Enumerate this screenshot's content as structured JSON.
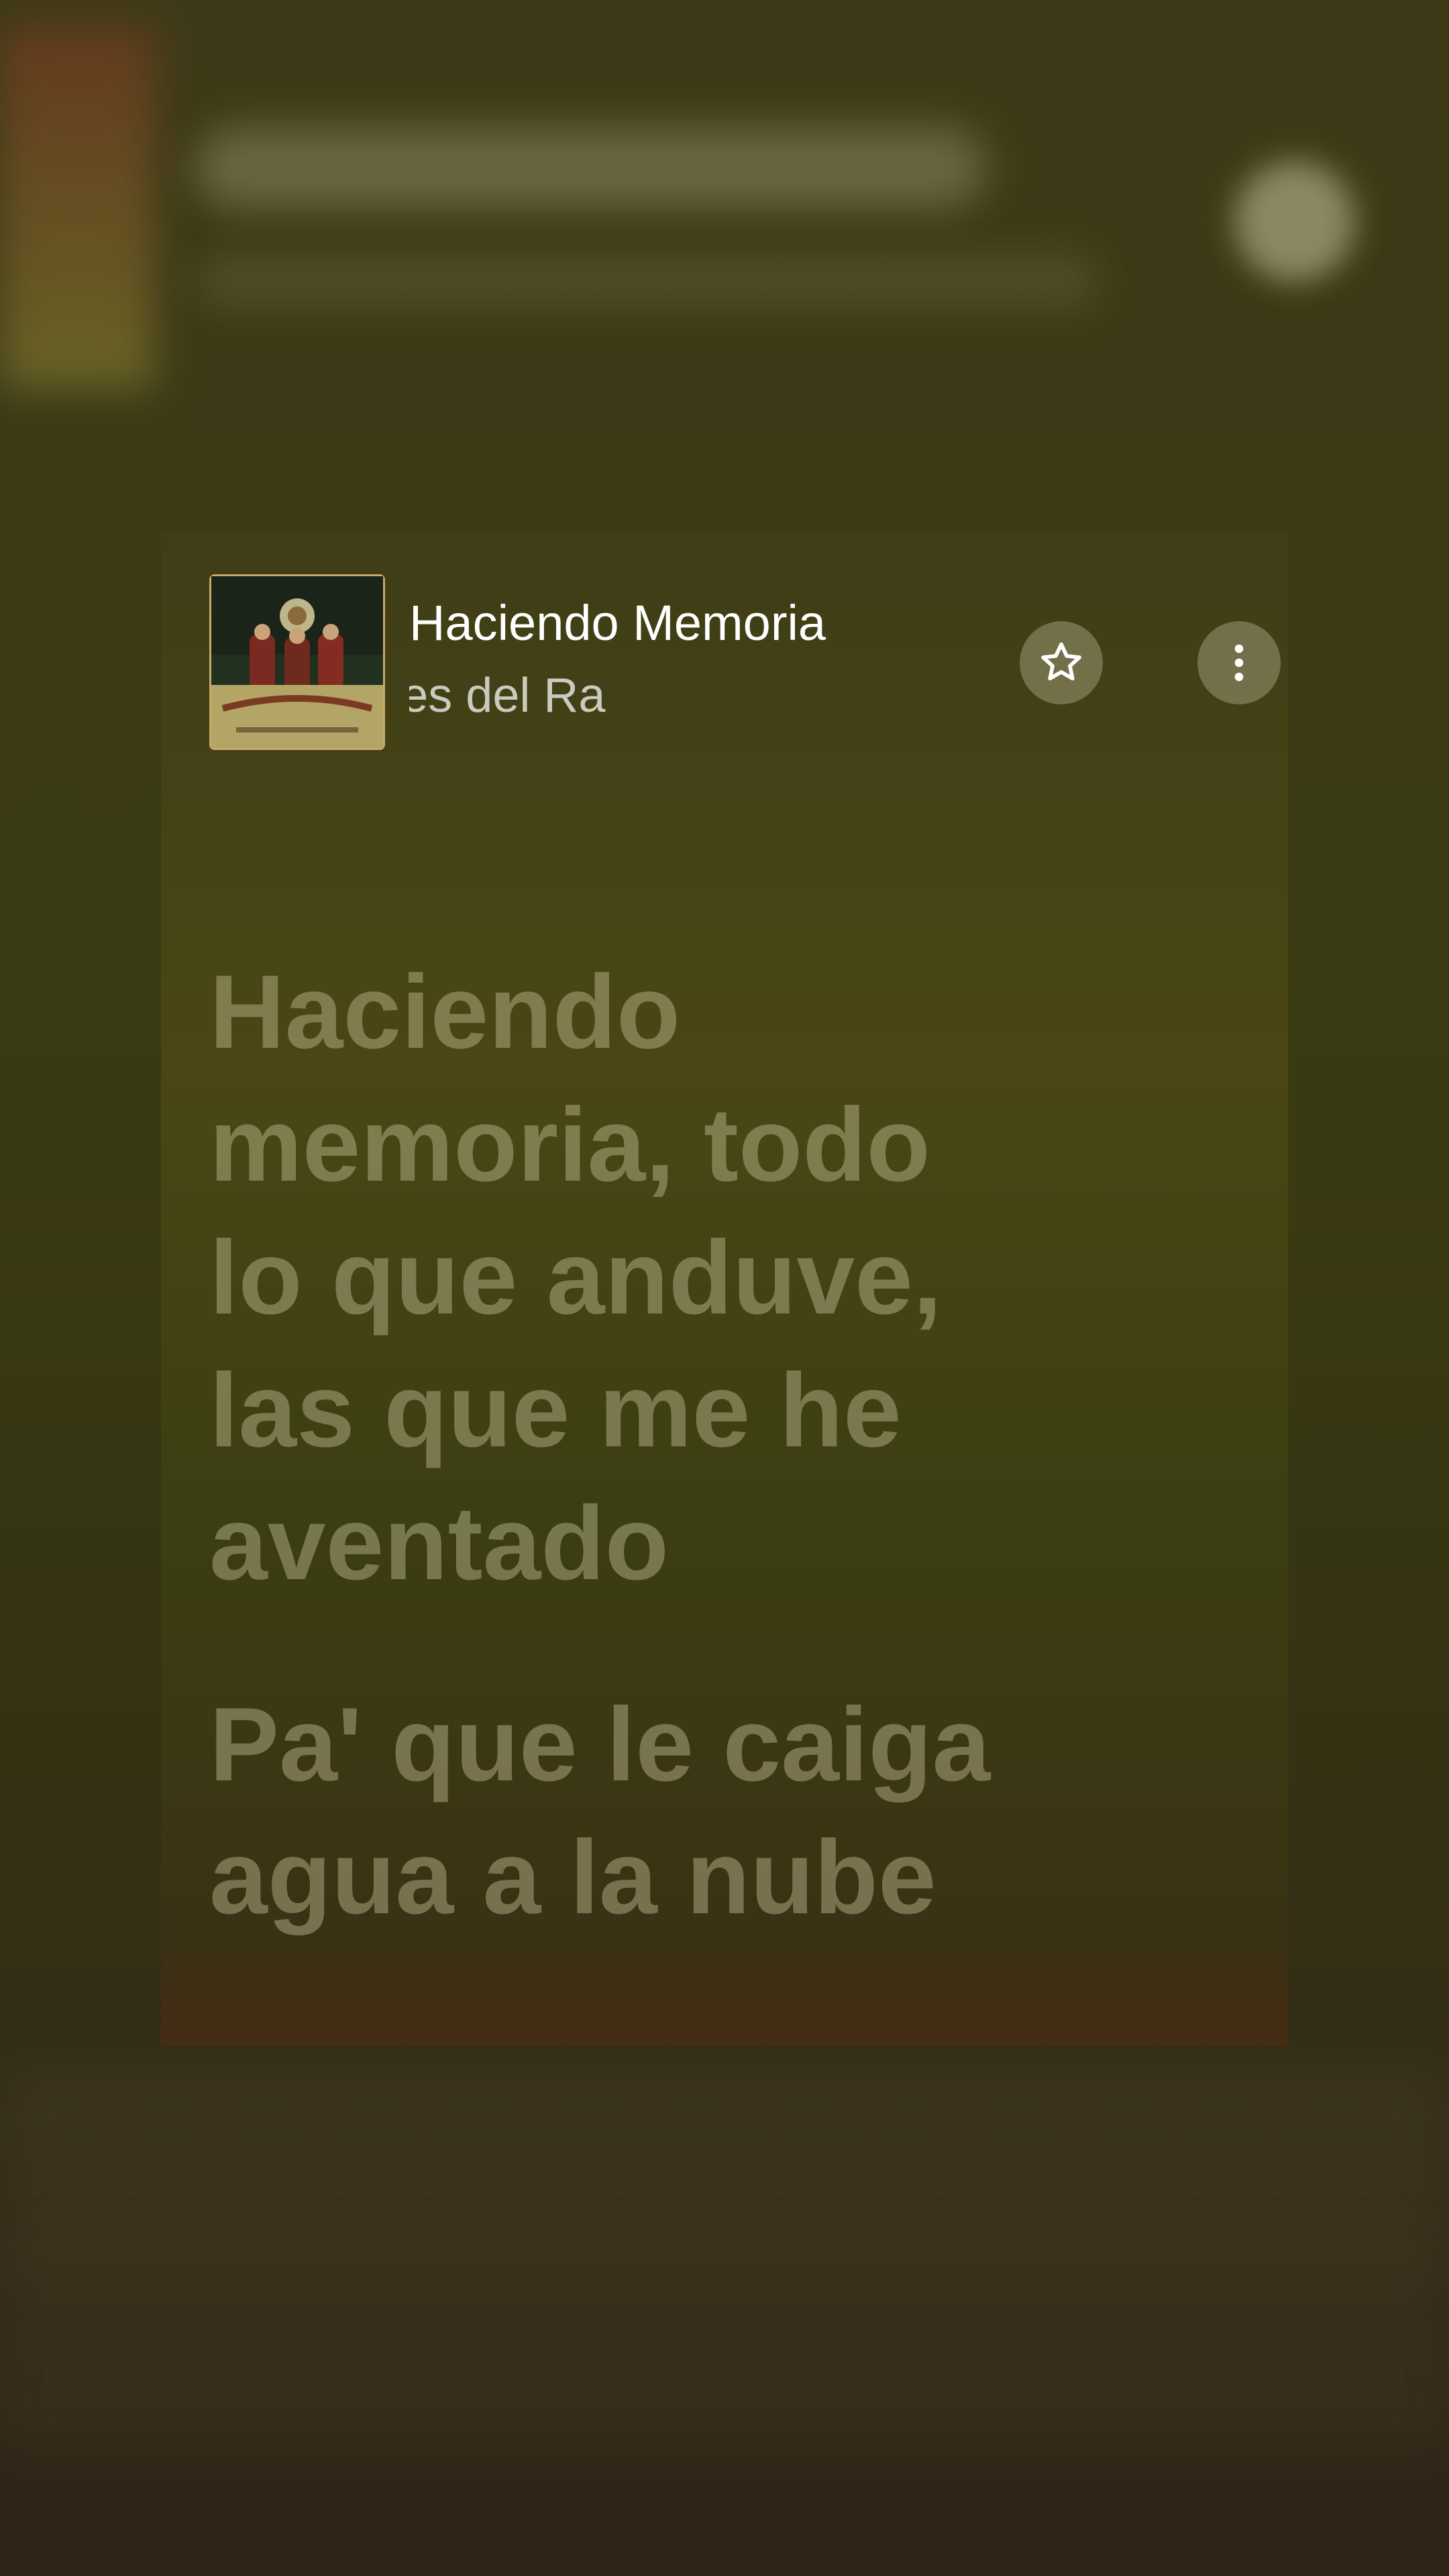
{
  "now_playing": {
    "title": "Haciendo Memoria",
    "artist_visible": "ma & Los Plebes del Ra",
    "album_art_icon": "album-art-image"
  },
  "actions": {
    "favorite_icon": "star-icon",
    "more_icon": "vertical-ellipsis-icon"
  },
  "lyrics": {
    "verses": [
      {
        "lines": [
          "Haciendo",
          "memoria, todo",
          "lo que anduve,",
          "las que me he",
          "aventado"
        ]
      },
      {
        "lines": [
          "Pa' que le caiga",
          "agua a la nube"
        ]
      }
    ]
  },
  "colors": {
    "background": "#3a3a14",
    "lyric_text": "#cdc8a0",
    "title_text": "#ffffff"
  }
}
